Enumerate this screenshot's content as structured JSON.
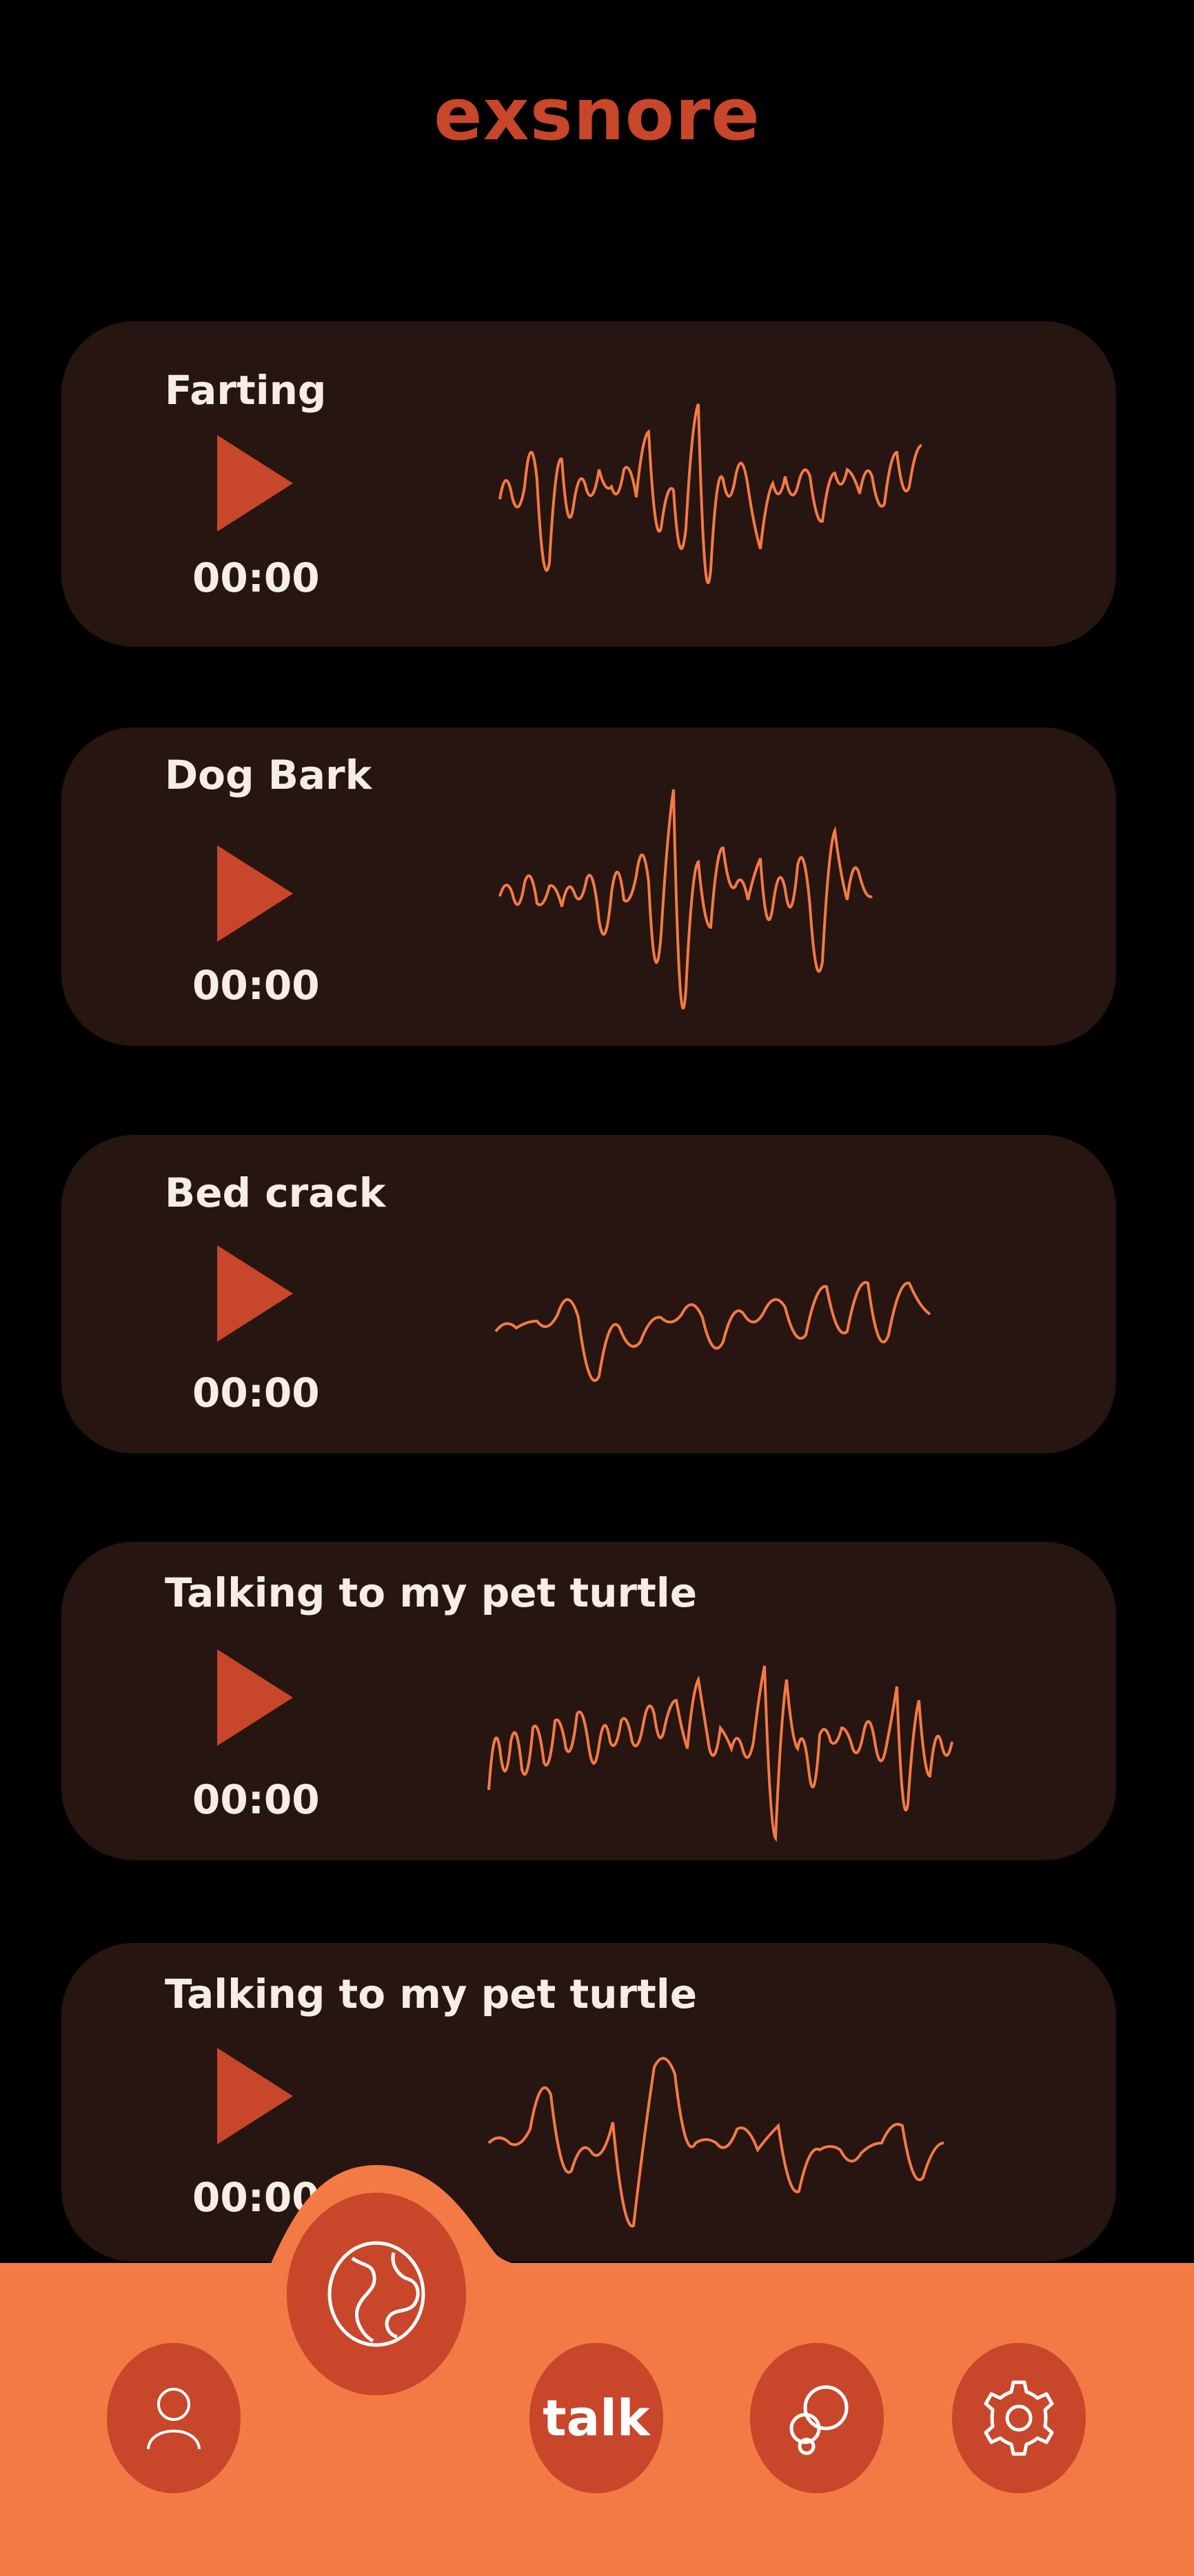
{
  "app": {
    "title": "exsnore"
  },
  "colors": {
    "background": "#000000",
    "card": "#261510",
    "accent": "#c8462a",
    "nav": "#f47a45",
    "waveform": "#f47a45",
    "text": "#f5ede6"
  },
  "recordings": [
    {
      "title": "Farting",
      "time": "00:00",
      "play_icon": "play-icon",
      "waveform_icon": "waveform-icon"
    },
    {
      "title": "Dog Bark",
      "time": "00:00",
      "play_icon": "play-icon",
      "waveform_icon": "waveform-icon"
    },
    {
      "title": "Bed crack",
      "time": "00:00",
      "play_icon": "play-icon",
      "waveform_icon": "waveform-icon"
    },
    {
      "title": "Talking to my pet turtle",
      "time": "00:00",
      "play_icon": "play-icon",
      "waveform_icon": "waveform-icon"
    },
    {
      "title": "Talking to my pet turtle",
      "time": "00:00",
      "play_icon": "play-icon",
      "waveform_icon": "waveform-icon"
    }
  ],
  "nav": {
    "items": [
      {
        "icon": "person-icon"
      },
      {
        "icon": "globe-icon"
      },
      {
        "label": "talk"
      },
      {
        "icon": "bubbles-icon"
      },
      {
        "icon": "gear-icon"
      }
    ]
  }
}
